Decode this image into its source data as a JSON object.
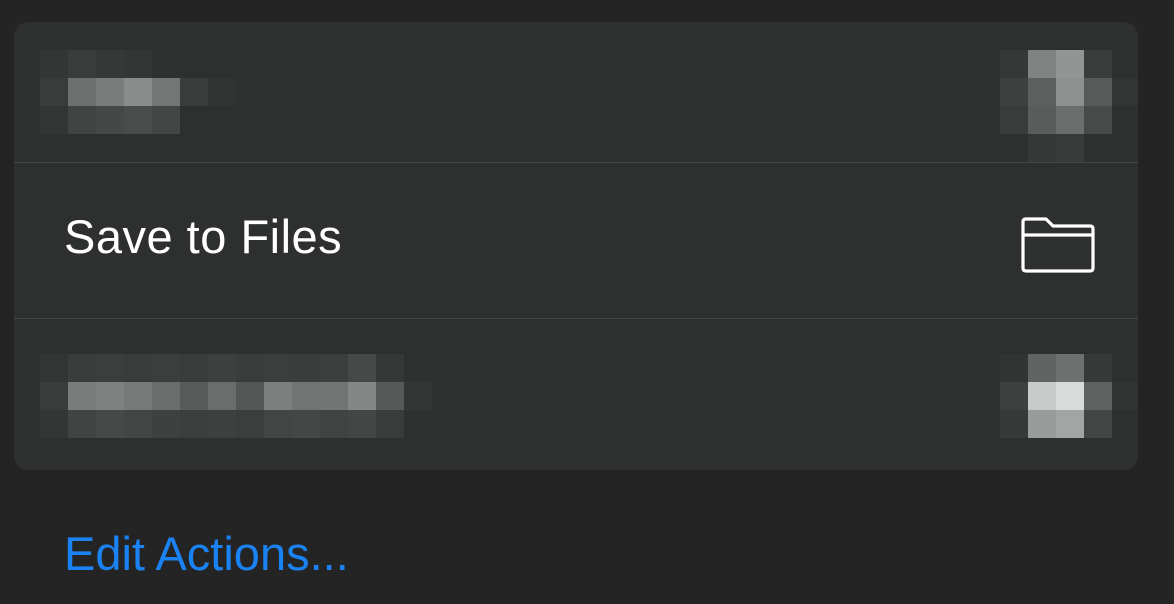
{
  "menu": {
    "items": [
      {
        "label": "",
        "icon": "redacted-icon",
        "redacted": true
      },
      {
        "label": "Save to Files",
        "icon": "folder-icon",
        "redacted": false
      },
      {
        "label": "",
        "icon": "redacted-icon",
        "redacted": true
      }
    ]
  },
  "footer": {
    "edit_actions_label": "Edit Actions..."
  },
  "colors": {
    "background": "#242424",
    "card": "#2e2f2f",
    "divider": "#454646",
    "text": "#ffffff",
    "accent": "#1a82f2"
  }
}
